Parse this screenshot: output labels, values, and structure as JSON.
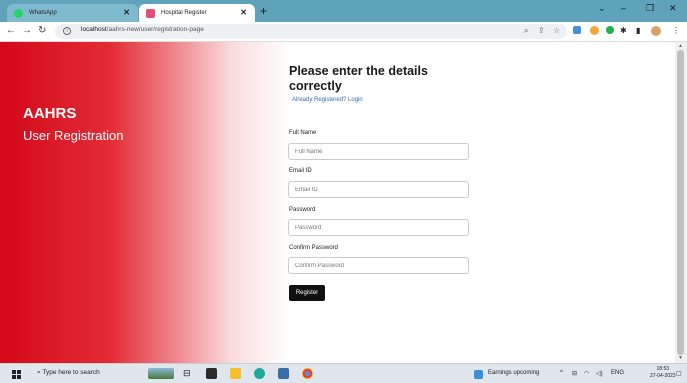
{
  "browser": {
    "tabs": [
      {
        "label": "WhatsApp",
        "active": false,
        "icon": "whatsapp-icon",
        "color": "#25d366"
      },
      {
        "label": "Hospital Register",
        "active": true,
        "icon": "hospital-icon",
        "color": "#e0507a"
      }
    ],
    "new_tab": "+",
    "window_controls": {
      "minimize": "–",
      "maximize": "❐",
      "close": "✕",
      "dropdown": "⌄"
    },
    "url_host": "localhost",
    "url_path": "/aahrs-new/user/registration-page"
  },
  "left_panel": {
    "brand": "AAHRS",
    "subtitle": "User Registration",
    "gradient_start": "#d4081a"
  },
  "form": {
    "heading": "Please enter the details correctly",
    "login_link": "Already Registered? Login",
    "fields": [
      {
        "label": "Full Name",
        "placeholder": "Full Name"
      },
      {
        "label": "Email ID",
        "placeholder": "Email ID"
      },
      {
        "label": "Password",
        "placeholder": "Password"
      },
      {
        "label": "Confirm Password",
        "placeholder": "Confirm Password"
      }
    ],
    "submit_label": "Register"
  },
  "taskbar": {
    "search_text": "Type here to search",
    "weather_text": "Earnings upcoming",
    "language": "ENG",
    "time": "18:53",
    "date": "27-04-2023"
  }
}
